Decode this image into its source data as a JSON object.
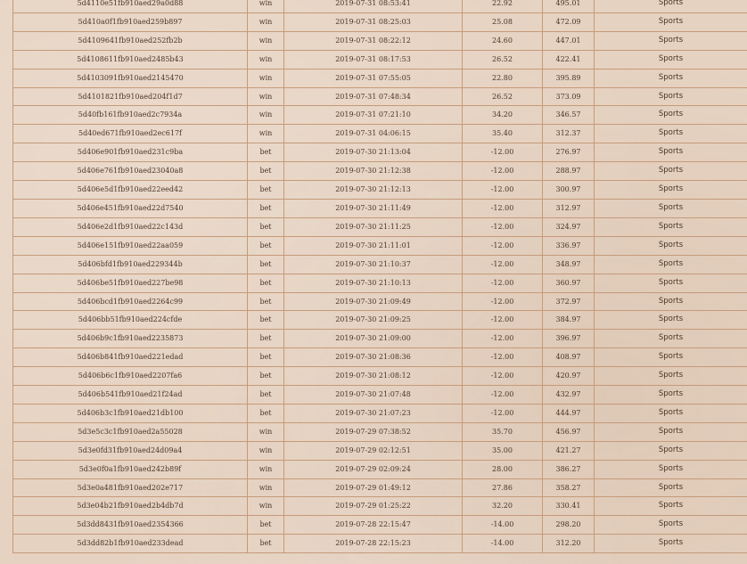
{
  "transactions": [
    {
      "id": "5d4110e51fb910aed29a0d88",
      "type": "win",
      "date": "2019-07-31 08:53:41",
      "amount": "22.92",
      "balance": "495.01",
      "category": "Sports"
    },
    {
      "id": "5d410a0f1fb910aed259b897",
      "type": "win",
      "date": "2019-07-31 08:25:03",
      "amount": "25.08",
      "balance": "472.09",
      "category": "Sports"
    },
    {
      "id": "5d4109641fb910aed252fb2b",
      "type": "win",
      "date": "2019-07-31 08:22:12",
      "amount": "24.60",
      "balance": "447.01",
      "category": "Sports"
    },
    {
      "id": "5d4108611fb910aed2485b43",
      "type": "win",
      "date": "2019-07-31 08:17:53",
      "amount": "26.52",
      "balance": "422.41",
      "category": "Sports"
    },
    {
      "id": "5d4103091fb910aed2145470",
      "type": "win",
      "date": "2019-07-31 07:55:05",
      "amount": "22.80",
      "balance": "395.89",
      "category": "Sports"
    },
    {
      "id": "5d4101821fb910aed204f1d7",
      "type": "win",
      "date": "2019-07-31 07:48:34",
      "amount": "26.52",
      "balance": "373.09",
      "category": "Sports"
    },
    {
      "id": "5d40fb161fb910aed2c7934a",
      "type": "win",
      "date": "2019-07-31 07:21:10",
      "amount": "34.20",
      "balance": "346.57",
      "category": "Sports"
    },
    {
      "id": "5d40ed671fb910aed2ec617f",
      "type": "win",
      "date": "2019-07-31 04:06:15",
      "amount": "35.40",
      "balance": "312.37",
      "category": "Sports"
    },
    {
      "id": "5d406e901fb910aed231c9ba",
      "type": "bet",
      "date": "2019-07-30 21:13:04",
      "amount": "-12.00",
      "balance": "276.97",
      "category": "Sports"
    },
    {
      "id": "5d406e761fb910aed23040a8",
      "type": "bet",
      "date": "2019-07-30 21:12:38",
      "amount": "-12.00",
      "balance": "288.97",
      "category": "Sports"
    },
    {
      "id": "5d406e5d1fb910aed22eed42",
      "type": "bet",
      "date": "2019-07-30 21:12:13",
      "amount": "-12.00",
      "balance": "300.97",
      "category": "Sports"
    },
    {
      "id": "5d406e451fb910aed22d7540",
      "type": "bet",
      "date": "2019-07-30 21:11:49",
      "amount": "-12.00",
      "balance": "312.97",
      "category": "Sports"
    },
    {
      "id": "5d406e2d1fb910aed22c143d",
      "type": "bet",
      "date": "2019-07-30 21:11:25",
      "amount": "-12.00",
      "balance": "324.97",
      "category": "Sports"
    },
    {
      "id": "5d406e151fb910aed22aa059",
      "type": "bet",
      "date": "2019-07-30 21:11:01",
      "amount": "-12.00",
      "balance": "336.97",
      "category": "Sports"
    },
    {
      "id": "5d406bfd1fb910aed229344b",
      "type": "bet",
      "date": "2019-07-30 21:10:37",
      "amount": "-12.00",
      "balance": "348.97",
      "category": "Sports"
    },
    {
      "id": "5d406be51fb910aed227be98",
      "type": "bet",
      "date": "2019-07-30 21:10:13",
      "amount": "-12.00",
      "balance": "360.97",
      "category": "Sports"
    },
    {
      "id": "5d406bcd1fb910aed2264c99",
      "type": "bet",
      "date": "2019-07-30 21:09:49",
      "amount": "-12.00",
      "balance": "372.97",
      "category": "Sports"
    },
    {
      "id": "5d406bb51fb910aed224cfde",
      "type": "bet",
      "date": "2019-07-30 21:09:25",
      "amount": "-12.00",
      "balance": "384.97",
      "category": "Sports"
    },
    {
      "id": "5d406b9c1fb910aed2235873",
      "type": "bet",
      "date": "2019-07-30 21:09:00",
      "amount": "-12.00",
      "balance": "396.97",
      "category": "Sports"
    },
    {
      "id": "5d406b841fb910aed221edad",
      "type": "bet",
      "date": "2019-07-30 21:08:36",
      "amount": "-12.00",
      "balance": "408.97",
      "category": "Sports"
    },
    {
      "id": "5d406b6c1fb910aed2207fa6",
      "type": "bet",
      "date": "2019-07-30 21:08:12",
      "amount": "-12.00",
      "balance": "420.97",
      "category": "Sports"
    },
    {
      "id": "5d406b541fb910aed21f24ad",
      "type": "bet",
      "date": "2019-07-30 21:07:48",
      "amount": "-12.00",
      "balance": "432.97",
      "category": "Sports"
    },
    {
      "id": "5d406b3c1fb910aed21db100",
      "type": "bet",
      "date": "2019-07-30 21:07:23",
      "amount": "-12.00",
      "balance": "444.97",
      "category": "Sports"
    },
    {
      "id": "5d3e5c3c1fb910aed2a55028",
      "type": "win",
      "date": "2019-07-29 07:38:52",
      "amount": "35.70",
      "balance": "456.97",
      "category": "Sports"
    },
    {
      "id": "5d3e0fd31fb910aed24d09a4",
      "type": "win",
      "date": "2019-07-29 02:12:51",
      "amount": "35.00",
      "balance": "421.27",
      "category": "Sports"
    },
    {
      "id": "5d3e0f0a1fb910aed242b89f",
      "type": "win",
      "date": "2019-07-29 02:09:24",
      "amount": "28.00",
      "balance": "386.27",
      "category": "Sports"
    },
    {
      "id": "5d3e0a481fb910aed202e717",
      "type": "win",
      "date": "2019-07-29 01:49:12",
      "amount": "27.86",
      "balance": "358.27",
      "category": "Sports"
    },
    {
      "id": "5d3e04b21fb910aed2b4db7d",
      "type": "win",
      "date": "2019-07-29 01:25:22",
      "amount": "32.20",
      "balance": "330.41",
      "category": "Sports"
    },
    {
      "id": "5d3dd8431fb910aed2354366",
      "type": "bet",
      "date": "2019-07-28 22:15:47",
      "amount": "-14.00",
      "balance": "298.20",
      "category": "Sports"
    },
    {
      "id": "5d3dd82b1fb910aed233dead",
      "type": "bet",
      "date": "2019-07-28 22:15:23",
      "amount": "-14.00",
      "balance": "312.20",
      "category": "Sports"
    }
  ]
}
